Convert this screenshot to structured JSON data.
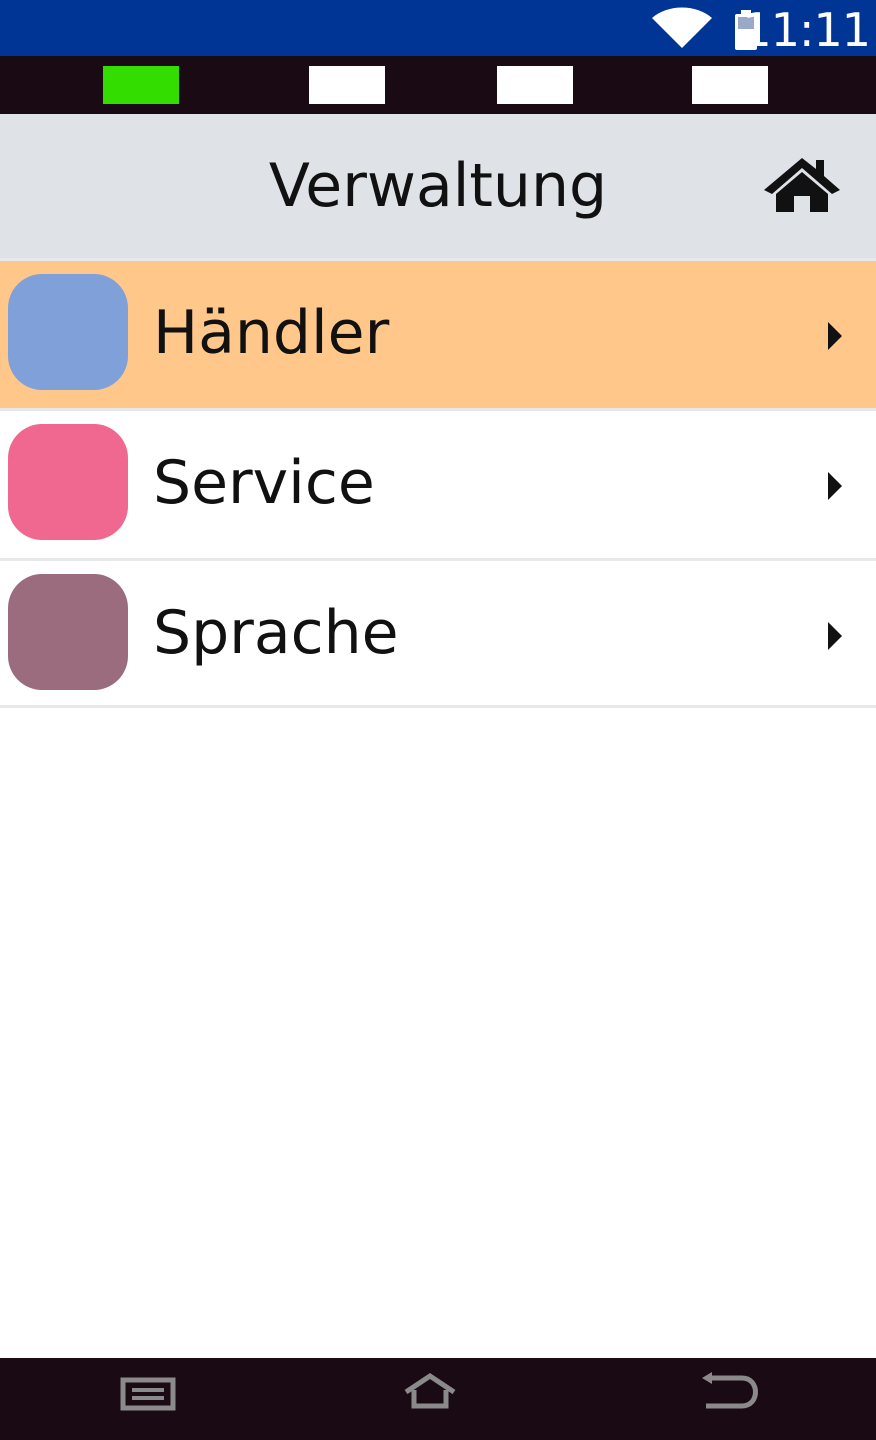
{
  "status_bar": {
    "time": "11:11",
    "background": "#003595",
    "icons": [
      "wifi-icon",
      "battery-icon"
    ]
  },
  "indicators": [
    {
      "state": "active",
      "color": "#33dd00"
    },
    {
      "state": "inactive",
      "color": "#ffffff"
    },
    {
      "state": "inactive",
      "color": "#ffffff"
    },
    {
      "state": "inactive",
      "color": "#ffffff"
    }
  ],
  "header": {
    "title": "Verwaltung",
    "back_icon": "arrow-left-icon",
    "home_icon": "home-icon",
    "background": "#dfe2e7"
  },
  "menu": {
    "items": [
      {
        "label": "Händler",
        "tile_color": "#7fa0d8",
        "selected": true,
        "highlight_color": "#ffc88a"
      },
      {
        "label": "Service",
        "tile_color": "#f06890",
        "selected": false
      },
      {
        "label": "Sprache",
        "tile_color": "#9a6c7e",
        "selected": false
      }
    ]
  },
  "nav_bar": {
    "buttons": [
      "recent-apps-icon",
      "home-icon",
      "back-icon"
    ]
  }
}
